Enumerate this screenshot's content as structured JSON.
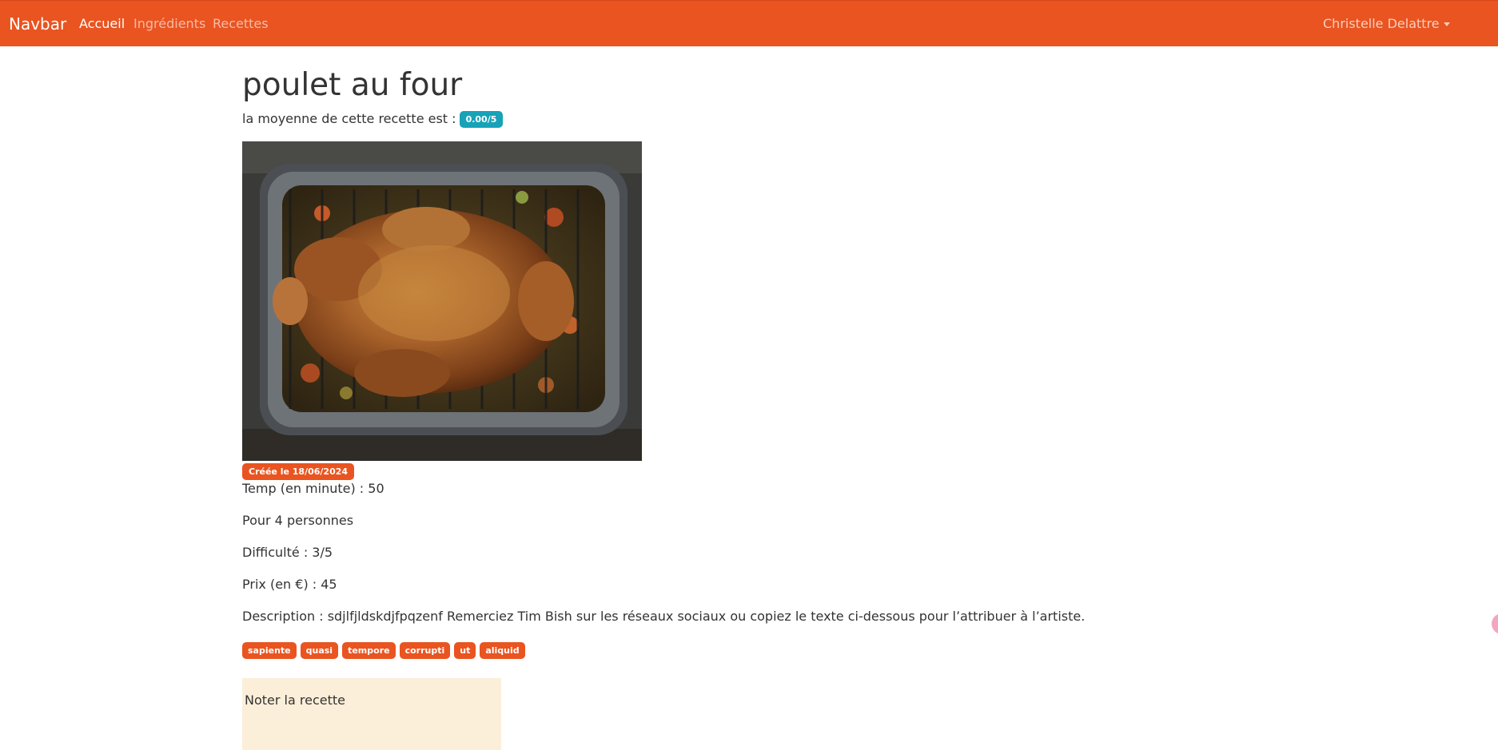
{
  "navbar": {
    "brand": "Navbar",
    "links": [
      {
        "label": "Accueil",
        "active": true
      },
      {
        "label": "Ingrédients",
        "active": false
      },
      {
        "label": "Recettes",
        "active": false
      }
    ],
    "user": "Christelle Delattre",
    "color": "#e95420"
  },
  "recipe": {
    "title": "poulet au four",
    "average_label": "la moyenne de cette recette est :",
    "average_value": "0.00/5",
    "created": "Créée le 18/06/2024",
    "time": "Temp (en minute) : 50",
    "people": "Pour 4 personnes",
    "difficulty": "Difficulté : 3/5",
    "price": "Prix (en €) : 45",
    "description": "Description : sdjlfjldskdjfpqzenf Remerciez Tim Bish sur les réseaux sociaux ou copiez le texte ci-dessous pour l’attribuer à l’artiste.",
    "tags": [
      "sapiente",
      "quasi",
      "tempore",
      "corrupti",
      "ut",
      "aliquid"
    ]
  },
  "rating": {
    "title": "Noter la recette"
  },
  "colors": {
    "accent": "#e95420",
    "info": "#17a2b8",
    "card": "#fcefd9"
  }
}
